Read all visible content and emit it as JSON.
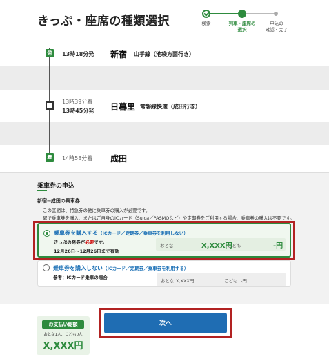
{
  "header": {
    "title": "きっぷ・座席の種類選択",
    "steps": [
      {
        "label": "検索"
      },
      {
        "label_line1": "列車・座席の",
        "label_line2": "選択"
      },
      {
        "label_line1": "申込の",
        "label_line2": "確認・完了"
      }
    ]
  },
  "route": {
    "departure": {
      "marker": "発",
      "time": "13時18分発",
      "station": "新宿",
      "line": "山手線（池袋方面行き）"
    },
    "transfer": {
      "arrive": "13時39分着",
      "depart": "13時45分発",
      "station": "日暮里",
      "line": "常磐線快速（成田行き）"
    },
    "arrival": {
      "marker": "着",
      "time": "14時58分着",
      "station": "成田"
    }
  },
  "ticket_section": {
    "title": "乗車券の申込",
    "subtitle": "新宿→成田の乗車券",
    "note1": "この区間は、特急券の他に乗車券の購入が必要です。",
    "note2": "駅で乗車券を購入、またはご自身のICカード（Suica／PASMOなど）や定期券をご利用する場合、乗車券の購入は不要です。",
    "option1": {
      "title": "乗車券を購入する",
      "title_note": "（ICカード／定期券／乗車券を利用しない）",
      "desc_pre": "きっぷの発券が",
      "desc_req": "必要",
      "desc_post": "です。",
      "valid": "12月26日〜12月26日まで有効",
      "adult_label": "おとな",
      "adult_price": "X,XXX円",
      "child_label": "こども",
      "child_price": "-円"
    },
    "option2": {
      "title": "乗車券を購入しない",
      "title_note": "（ICカード／定期券／乗車券を利用する）",
      "desc": "参考：ICカード乗車の場合",
      "adult_label": "おとな",
      "adult_price": "X,XXX円",
      "child_label": "こども",
      "child_price": "-円"
    }
  },
  "footer": {
    "pay_title": "お支払い総額",
    "pay_sub": "おとな1人、こども0人",
    "pay_total": "X,XXX円",
    "next_label": "次へ"
  }
}
